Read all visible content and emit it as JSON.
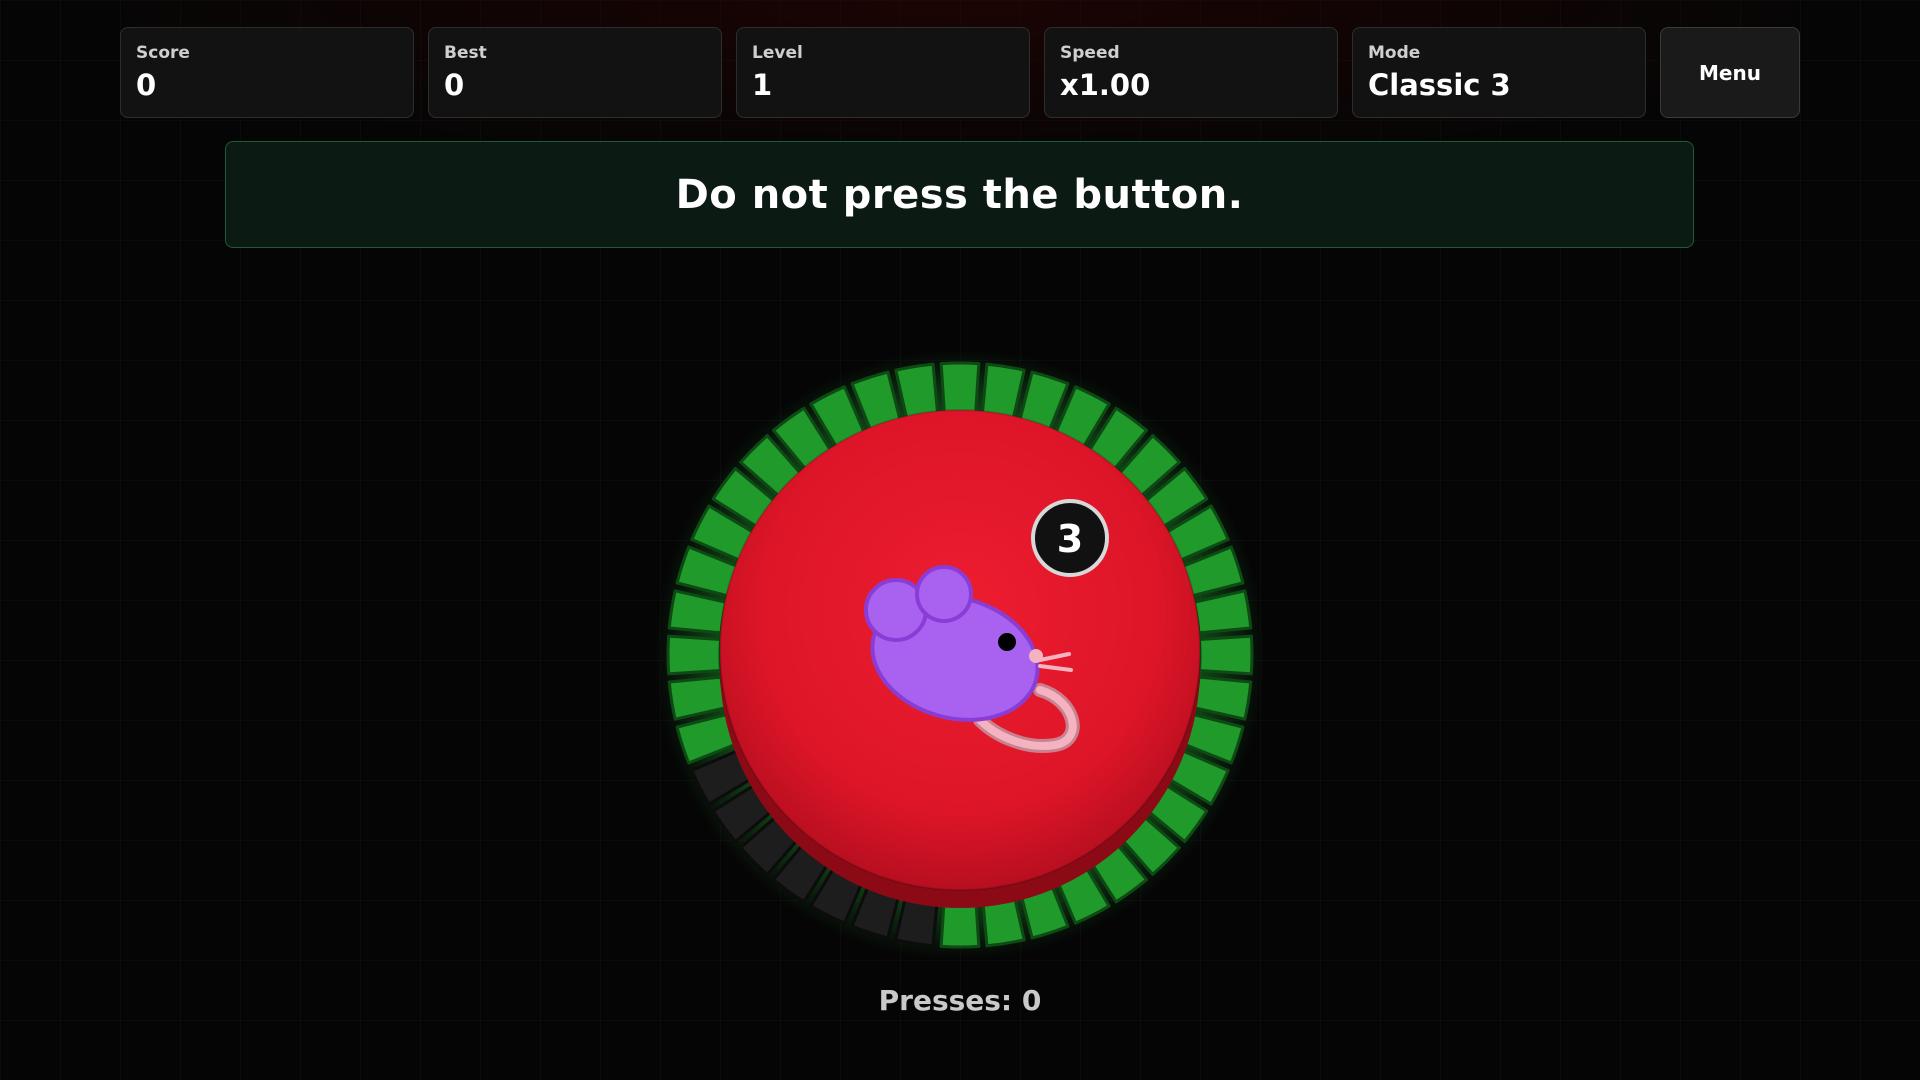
{
  "hud": {
    "score": {
      "label": "Score",
      "value": "0"
    },
    "best": {
      "label": "Best",
      "value": "0"
    },
    "level": {
      "label": "Level",
      "value": "1"
    },
    "speed": {
      "label": "Speed",
      "value": "x1.00"
    },
    "mode": {
      "label": "Mode",
      "value": "Classic 3"
    },
    "menu_label": "Menu"
  },
  "instruction": "Do not press the button.",
  "button": {
    "color": "#d91426",
    "icon": "mouse-icon",
    "countdown": "3",
    "timer_ring": {
      "segments_total": 40,
      "segments_remaining": 33,
      "active_color": "#1f9a2b",
      "inactive_color": "#1d1d1d"
    }
  },
  "presses": {
    "label": "Presses:",
    "value": "0"
  },
  "colors": {
    "background": "#050505",
    "panel": "#121212",
    "banner_border": "#1f5a36",
    "glow": "#27c23a"
  }
}
